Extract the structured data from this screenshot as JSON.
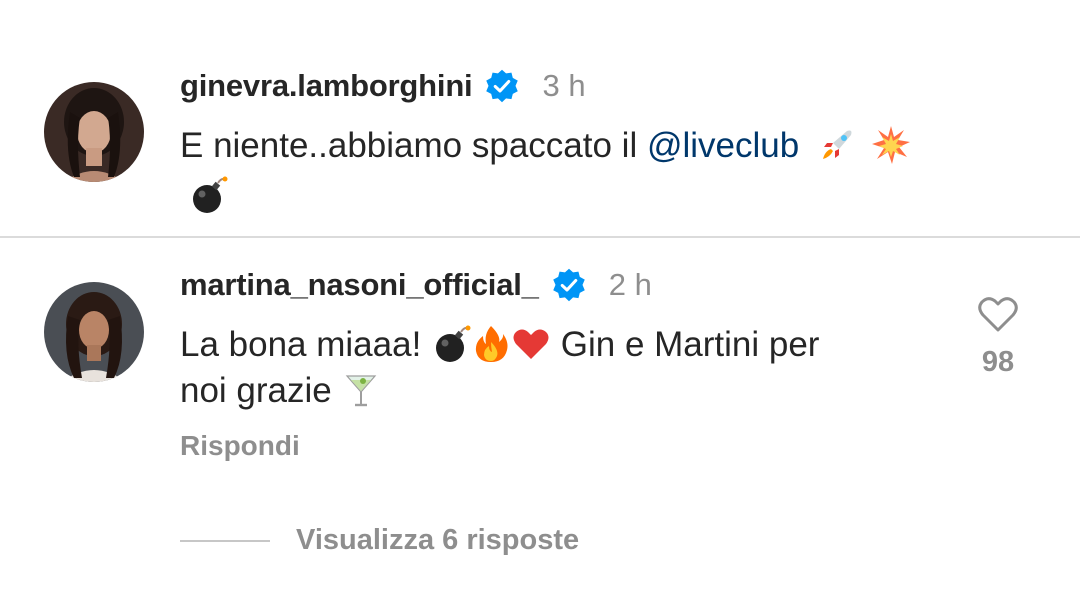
{
  "comments": [
    {
      "username": "ginevra.lamborghini",
      "verified": true,
      "time": "3 h",
      "text_before": "E niente..abbiamo spaccato il ",
      "mention": "@liveclub",
      "emojis_line1": [
        "rocket-emoji",
        "collision-emoji"
      ],
      "emojis_line2": [
        "bomb-emoji"
      ]
    },
    {
      "username": "martina_nasoni_official_",
      "verified": true,
      "time": "2 h",
      "text_part1": "La bona miaaa! ",
      "emojis_inline": [
        "bomb-emoji",
        "fire-emoji",
        "red-heart-emoji"
      ],
      "text_part2": " Gin e Martini per",
      "text_line2": "noi grazie ",
      "emojis_line2": [
        "cocktail-glass-emoji"
      ],
      "like_count": "98",
      "reply_label": "Rispondi",
      "view_replies_label": "Visualizza 6 risposte"
    }
  ],
  "colors": {
    "text": "#262626",
    "secondary": "#8e8e8e",
    "mention": "#00376b",
    "verified": "#0095f6",
    "divider": "#dbdbdb"
  }
}
